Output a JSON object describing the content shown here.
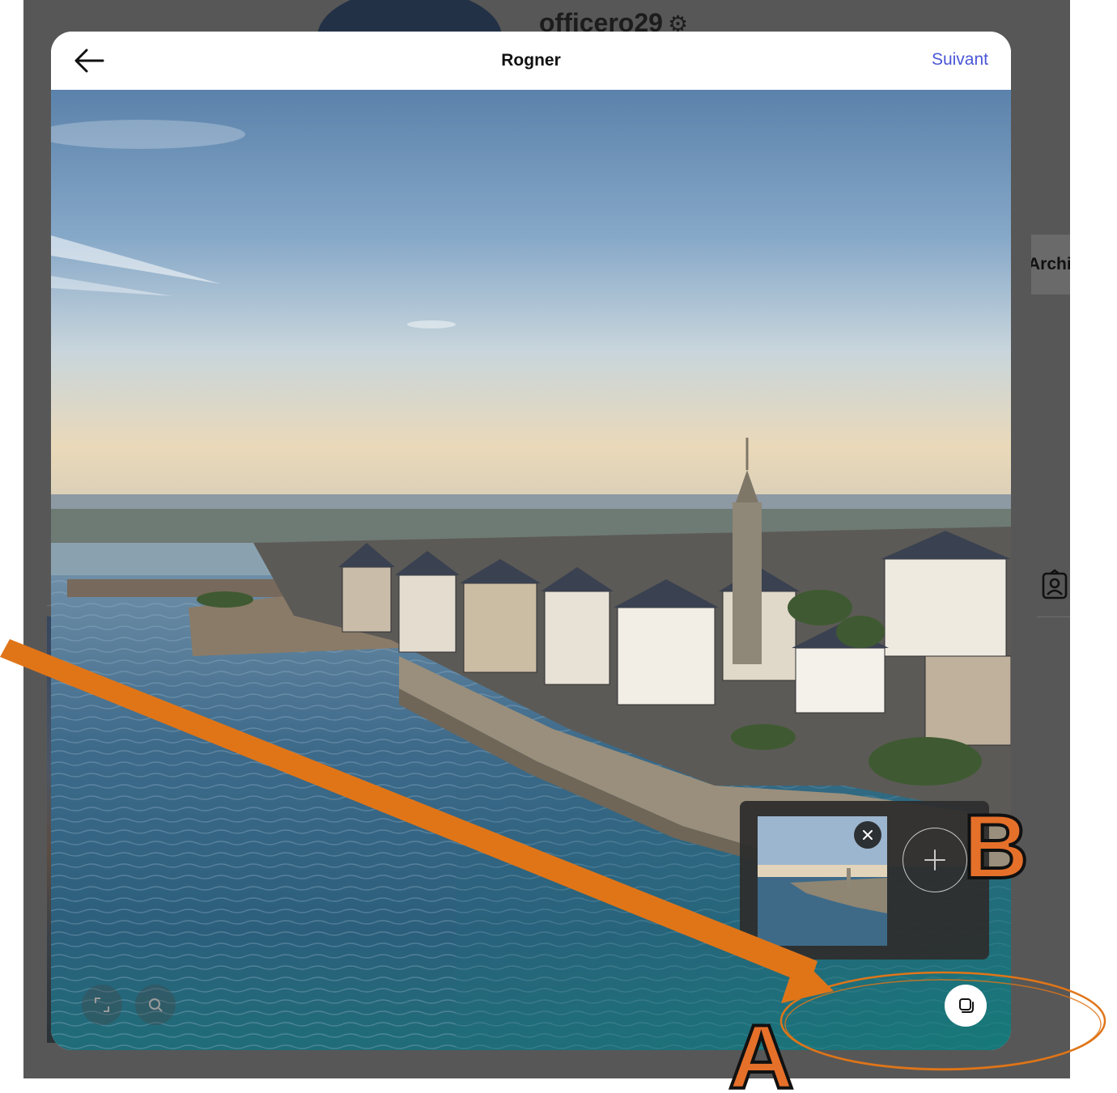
{
  "background_profile": {
    "username": "officero29",
    "archive_label": "Archive"
  },
  "modal": {
    "title": "Rogner",
    "next_label": "Suivant"
  },
  "annotations": {
    "label_a": "A",
    "label_b": "B",
    "accent_color": "#e07518"
  },
  "icons": {
    "back": "arrow-left-icon",
    "settings": "gear-icon",
    "tagged": "tagged-user-icon",
    "aspect": "crop-aspect-icon",
    "zoom": "zoom-icon",
    "multi_select": "multi-select-icon",
    "remove": "close-icon",
    "add": "plus-icon"
  }
}
